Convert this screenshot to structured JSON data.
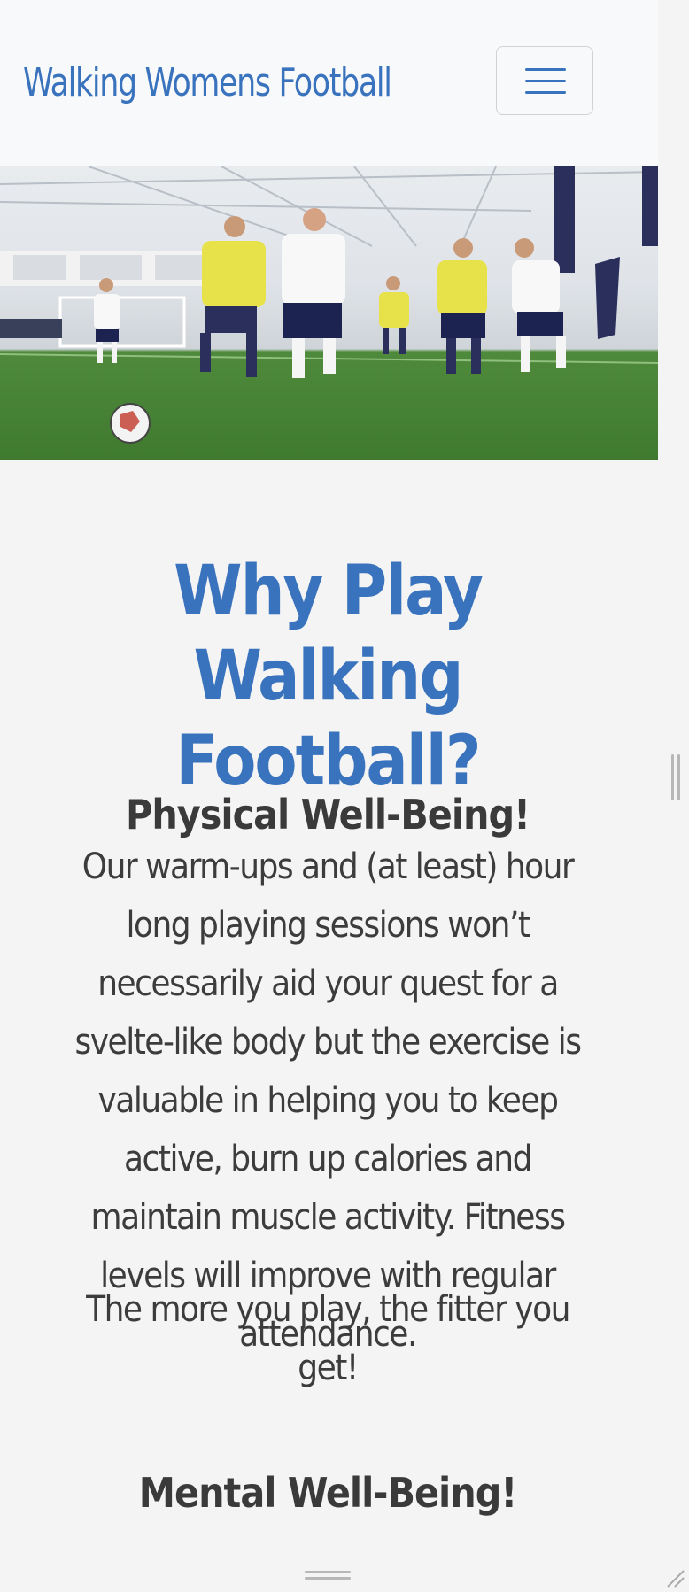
{
  "navbar": {
    "brand": "Walking Womens Football",
    "menu_icon": "hamburger-menu-icon"
  },
  "hero": {
    "image": "women-walking-football-indoor-pitch-photo"
  },
  "main": {
    "heading": "Why Play Walking Football?",
    "sections": [
      {
        "title": "Physical Well-Being!",
        "paragraphs": [
          "Our warm-ups and (at least) hour long playing sessions won’t necessarily aid your quest for a svelte-like body but the exercise is valuable in helping you to keep active, burn up calories and maintain muscle activity. Fitness levels will improve with regular attendance.",
          "The more you play, the fitter you get!"
        ]
      },
      {
        "title": "Mental Well-Being!"
      }
    ]
  },
  "colors": {
    "brand_blue": "#3a73bd",
    "text_dark": "#3c3c3c",
    "navbar_bg": "#f8f9fa",
    "page_bg": "#f4f4f4"
  }
}
